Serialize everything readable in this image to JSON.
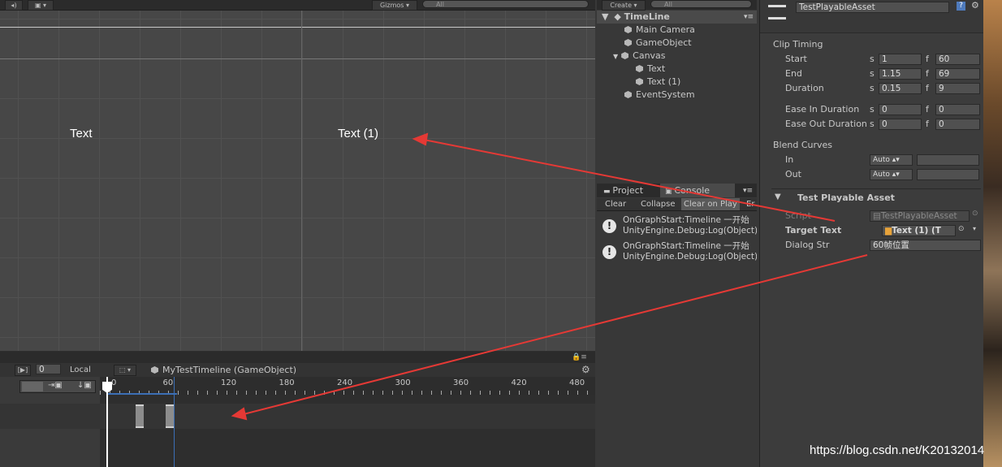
{
  "scene": {
    "gizmos_label": "Gizmos",
    "search_placeholder": "All",
    "texts": [
      "Text",
      "Text (1)"
    ]
  },
  "timeline": {
    "frame_value": "0",
    "local_label": "Local",
    "asset_title": "MyTestTimeline (GameObject)",
    "ruler_labels": [
      "0",
      "60",
      "120",
      "180",
      "240",
      "300",
      "360",
      "420",
      "480"
    ]
  },
  "hierarchy": {
    "create_label": "Create",
    "search_placeholder": "All",
    "root": "TimeLine",
    "items": [
      "Main Camera",
      "GameObject",
      "Canvas",
      "Text",
      "Text (1)",
      "EventSystem"
    ]
  },
  "console": {
    "tabs": [
      "Project",
      "Console"
    ],
    "toolbar": [
      "Clear",
      "Collapse",
      "Clear on Play",
      "Er"
    ],
    "entries": [
      {
        "line1": "OnGraphStart:Timeline 一开始",
        "line2": "UnityEngine.Debug:Log(Object)"
      },
      {
        "line1": "OnGraphStart:Timeline 一开始",
        "line2": "UnityEngine.Debug:Log(Object)"
      }
    ]
  },
  "inspector": {
    "asset_name": "TestPlayableAsset",
    "clip_timing": {
      "heading": "Clip Timing",
      "rows": [
        {
          "label": "Start",
          "s": "1",
          "f": "60"
        },
        {
          "label": "End",
          "s": "1.15",
          "f": "69"
        },
        {
          "label": "Duration",
          "s": "0.15",
          "f": "9"
        },
        {
          "label": "Ease In Duration",
          "s": "0",
          "f": "0"
        },
        {
          "label": "Ease Out Duration",
          "s": "0",
          "f": "0"
        }
      ],
      "s_unit": "s",
      "f_unit": "f"
    },
    "blend_curves": {
      "heading": "Blend Curves",
      "in_label": "In",
      "out_label": "Out",
      "in_value": "Auto",
      "out_value": "Auto"
    },
    "component": {
      "heading": "Test Playable Asset",
      "script_label": "Script",
      "script_value": "TestPlayableAsset",
      "target_label": "Target Text",
      "target_value": "Text (1) (T",
      "dialog_label": "Dialog Str",
      "dialog_value": "60帧位置"
    }
  },
  "watermark": "https://blog.csdn.net/K20132014",
  "colors": {
    "annotation_arrow": "#e53935",
    "accent_blue": "#3b6fb6"
  }
}
